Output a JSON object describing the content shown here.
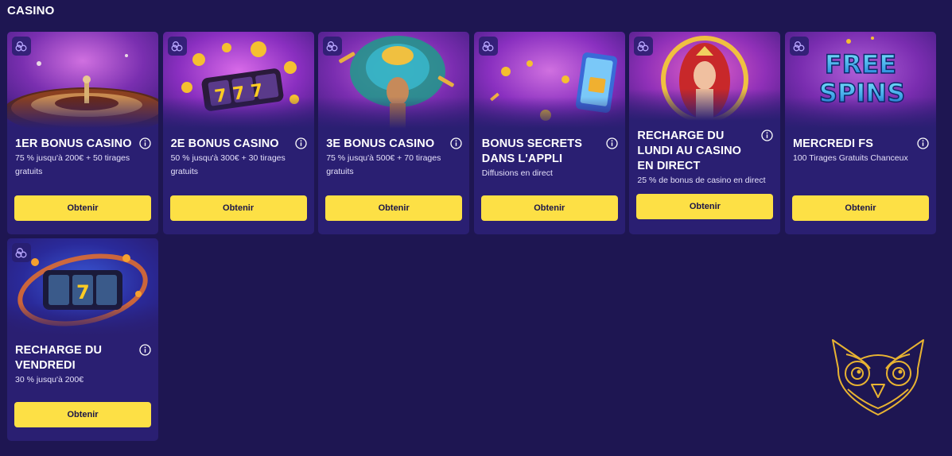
{
  "section": {
    "title": "CASINO"
  },
  "colors": {
    "background": "#1e1652",
    "card": "#2a1f72",
    "button": "#fde045",
    "owl": "#e8b332"
  },
  "cards": [
    {
      "title": "1ER BONUS CASINO",
      "description": "75 % jusqu'à 200€ + 50 tirages gratuits",
      "button": "Obtenir",
      "image": "roulette-wheel"
    },
    {
      "title": "2E BONUS CASINO",
      "description": "50 % jusqu'à 300€ + 30 tirages gratuits",
      "button": "Obtenir",
      "image": "slot-777-coins"
    },
    {
      "title": "3E BONUS CASINO",
      "description": "75 % jusqu'à 500€ + 70 tirages gratuits",
      "button": "Obtenir",
      "image": "carnival-dancer"
    },
    {
      "title": "BONUS SECRETS DANS L'APPLI",
      "description": "Diffusions en direct",
      "button": "Obtenir",
      "image": "phone-gift"
    },
    {
      "title": "RECHARGE DU LUNDI AU CASINO EN DIRECT",
      "description": "25 % de bonus de casino en direct",
      "button": "Obtenir",
      "image": "red-haired-queen"
    },
    {
      "title": "MERCREDI FS",
      "description": "100 Tirages Gratuits Chanceux",
      "button": "Obtenir",
      "image": "free-spins-text",
      "image_text": [
        "FREE",
        "SPINS"
      ]
    },
    {
      "title": "RECHARGE DU VENDREDI",
      "description": "30 % jusqu'à 200€",
      "button": "Obtenir",
      "image": "slot-reels-fire"
    }
  ],
  "logo": {
    "icon": "owl-icon"
  }
}
